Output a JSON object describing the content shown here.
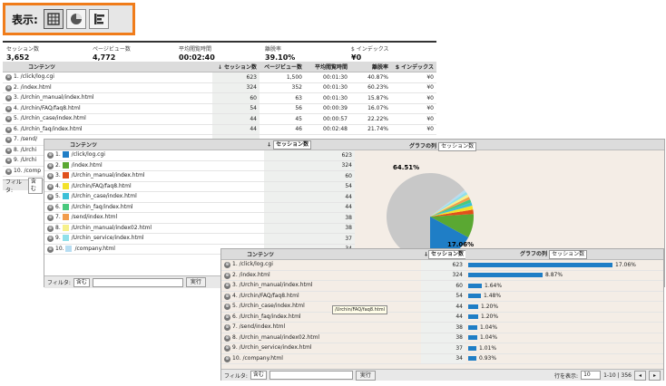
{
  "view_selector": {
    "label": "表示:"
  },
  "metrics": [
    {
      "title": "セッション数",
      "value": "3,652"
    },
    {
      "title": "ページビュー数",
      "value": "4,772"
    },
    {
      "title": "平均閲覧時間",
      "value": "00:02:40"
    },
    {
      "title": "離脱率",
      "value": "39.10%"
    },
    {
      "title": "$ インデックス",
      "value": "¥0"
    }
  ],
  "table_view": {
    "headers": [
      "コンテンツ",
      "セッション数",
      "ページビュー数",
      "平均閲覧時間",
      "離脱率",
      "$ インデックス"
    ],
    "sort_arrow": "↓",
    "rows": [
      {
        "idx": "1.",
        "page": "/click/log.cgi",
        "sessions": "623",
        "pv": "1,500",
        "time": "00:01:30",
        "exit": "40.87%",
        "idx_val": "¥0"
      },
      {
        "idx": "2.",
        "page": "/index.html",
        "sessions": "324",
        "pv": "352",
        "time": "00:01:30",
        "exit": "60.23%",
        "idx_val": "¥0"
      },
      {
        "idx": "3.",
        "page": "/Urchin_manual/index.html",
        "sessions": "60",
        "pv": "63",
        "time": "00:01:30",
        "exit": "15.87%",
        "idx_val": "¥0"
      },
      {
        "idx": "4.",
        "page": "/Urchin/FAQ/faq8.html",
        "sessions": "54",
        "pv": "56",
        "time": "00:00:39",
        "exit": "16.07%",
        "idx_val": "¥0"
      },
      {
        "idx": "5.",
        "page": "/Urchin_case/index.html",
        "sessions": "44",
        "pv": "45",
        "time": "00:00:57",
        "exit": "22.22%",
        "idx_val": "¥0"
      },
      {
        "idx": "6.",
        "page": "/Urchin_faq/index.html",
        "sessions": "44",
        "pv": "46",
        "time": "00:02:48",
        "exit": "21.74%",
        "idx_val": "¥0"
      },
      {
        "idx": "7.",
        "page": "/send/",
        "sessions": "",
        "pv": "",
        "time": "",
        "exit": "",
        "idx_val": ""
      },
      {
        "idx": "8.",
        "page": "/Urchi",
        "sessions": "",
        "pv": "",
        "time": "",
        "exit": "",
        "idx_val": ""
      },
      {
        "idx": "9.",
        "page": "/Urchi",
        "sessions": "",
        "pv": "",
        "time": "",
        "exit": "",
        "idx_val": ""
      },
      {
        "idx": "10.",
        "page": "/comp",
        "sessions": "",
        "pv": "",
        "time": "",
        "exit": "",
        "idx_val": ""
      }
    ],
    "filter_label": "フィルタ:",
    "filter_select": "含む"
  },
  "pie_view": {
    "headers": [
      "コンテンツ",
      "セッション数",
      "グラフの列"
    ],
    "metric_select": "セッション数",
    "rows": [
      {
        "idx": "1.",
        "page": "/click/log.cgi",
        "sessions": "623",
        "color": "#1f7ec6"
      },
      {
        "idx": "2.",
        "page": "/index.html",
        "sessions": "324",
        "color": "#5aa832"
      },
      {
        "idx": "3.",
        "page": "/Urchin_manual/index.html",
        "sessions": "60",
        "color": "#e0501b"
      },
      {
        "idx": "4.",
        "page": "/Urchin/FAQ/faq8.html",
        "sessions": "54",
        "color": "#f2e22a"
      },
      {
        "idx": "5.",
        "page": "/Urchin_case/index.html",
        "sessions": "44",
        "color": "#3cc0d8"
      },
      {
        "idx": "6.",
        "page": "/Urchin_faq/index.html",
        "sessions": "44",
        "color": "#49c97d"
      },
      {
        "idx": "7.",
        "page": "/send/index.html",
        "sessions": "38",
        "color": "#f29d4c"
      },
      {
        "idx": "8.",
        "page": "/Urchin_manual/index02.html",
        "sessions": "38",
        "color": "#f6f08a"
      },
      {
        "idx": "9.",
        "page": "/Urchin_service/index.html",
        "sessions": "37",
        "color": "#8fe0ea"
      },
      {
        "idx": "10.",
        "page": "/company.html",
        "sessions": "34",
        "color": "#b7ddf2"
      }
    ],
    "pie_labels": {
      "big": "64.51%",
      "small": "17.06%"
    },
    "other_color": "#c8c8c8",
    "filter_label": "フィルタ:",
    "filter_select": "含む",
    "filter_button": "実行"
  },
  "bar_view": {
    "headers": [
      "コンテンツ",
      "セッション数",
      "グラフの列"
    ],
    "metric_select": "セッション数",
    "rows": [
      {
        "idx": "1.",
        "page": "/click/log.cgi",
        "sessions": "623",
        "pct": "17.06%",
        "share": 17.06
      },
      {
        "idx": "2.",
        "page": "/index.html",
        "sessions": "324",
        "pct": "8.87%",
        "share": 8.87
      },
      {
        "idx": "3.",
        "page": "/Urchin_manual/index.html",
        "sessions": "60",
        "pct": "1.64%",
        "share": 1.64
      },
      {
        "idx": "4.",
        "page": "/Urchin/FAQ/faq8.html",
        "sessions": "54",
        "pct": "1.48%",
        "share": 1.48
      },
      {
        "idx": "5.",
        "page": "/Urchin_case/index.html",
        "sessions": "44",
        "pct": "1.20%",
        "share": 1.2
      },
      {
        "idx": "6.",
        "page": "/Urchin_faq/index.html",
        "sessions": "44",
        "pct": "1.20%",
        "share": 1.2
      },
      {
        "idx": "7.",
        "page": "/send/index.html",
        "sessions": "38",
        "pct": "1.04%",
        "share": 1.04
      },
      {
        "idx": "8.",
        "page": "/Urchin_manual/index02.html",
        "sessions": "38",
        "pct": "1.04%",
        "share": 1.04
      },
      {
        "idx": "9.",
        "page": "/Urchin_service/index.html",
        "sessions": "37",
        "pct": "1.01%",
        "share": 1.01
      },
      {
        "idx": "10.",
        "page": "/company.html",
        "sessions": "34",
        "pct": "0.93%",
        "share": 0.93
      }
    ],
    "tooltip": "/Urchin/FAQ/faq8.html",
    "filter_label": "フィルタ:",
    "filter_select": "含む",
    "filter_button": "実行",
    "rows_label": "行を表示:",
    "rows_select": "10",
    "page_range": "1-10 | 356",
    "prev": "◂",
    "next": "▸"
  }
}
